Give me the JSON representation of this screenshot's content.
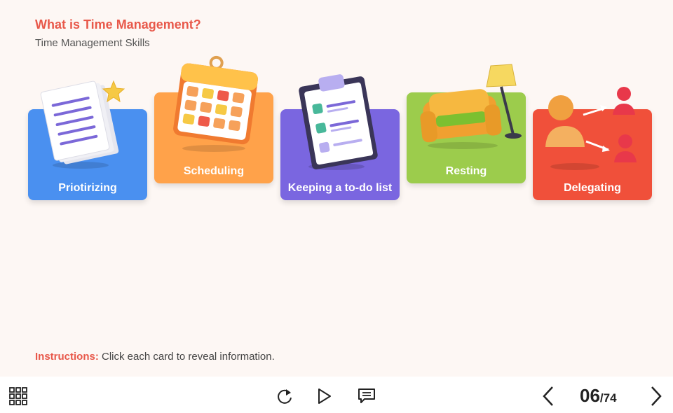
{
  "header": {
    "title": "What is Time Management?",
    "subtitle": "Time Management Skills"
  },
  "cards": [
    {
      "label": "Priotirizing",
      "color": "#4a90f0",
      "illustration": "document-star-icon"
    },
    {
      "label": "Scheduling",
      "color": "#ffa24a",
      "illustration": "calendar-icon"
    },
    {
      "label": "Keeping a to-do list",
      "color": "#7a66e0",
      "illustration": "clipboard-checklist-icon"
    },
    {
      "label": "Resting",
      "color": "#9ccc4c",
      "illustration": "armchair-lamp-icon"
    },
    {
      "label": "Delegating",
      "color": "#f0503a",
      "illustration": "people-arrows-icon"
    }
  ],
  "instructions": {
    "lead": "Instructions:",
    "text": " Click each card to reveal information."
  },
  "footer": {
    "menu_icon": "grid-menu-icon",
    "replay_icon": "replay-icon",
    "play_icon": "play-icon",
    "notes_icon": "notes-icon",
    "prev_icon": "chevron-left-icon",
    "next_icon": "chevron-right-icon",
    "page_current": "06",
    "page_total": "/74"
  },
  "colors": {
    "accent": "#e8584a",
    "background": "#fdf7f4"
  }
}
